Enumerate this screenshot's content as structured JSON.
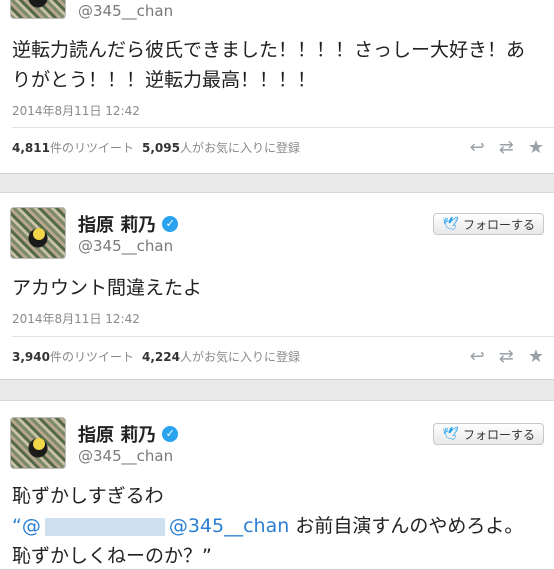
{
  "tweets": [
    {
      "handle": "@345__chan",
      "text_lines": [
        "逆転力読んだら彼氏できました！！！！さっしー大好き！あ",
        "りがとう！！！逆転力最高！！！！"
      ],
      "date": "2014年8月11日 12:42",
      "retweets": "4,811",
      "retweets_label": "件のリツイート",
      "favorites": "5,095",
      "favorites_label": "人がお気に入りに登録"
    },
    {
      "name": "指原 莉乃",
      "handle": "@345__chan",
      "follow_label": "フォローする",
      "text_lines": [
        "アカウント間違えたよ"
      ],
      "date": "2014年8月11日 12:42",
      "retweets": "3,940",
      "retweets_label": "件のリツイート",
      "favorites": "4,224",
      "favorites_label": "人がお気に入りに登録"
    },
    {
      "name": "指原 莉乃",
      "handle": "@345__chan",
      "follow_label": "フォローする",
      "line1": "恥ずかしすぎるわ",
      "open_quote": "“@",
      "mention": "@345__chan",
      "line2_rest": " お前自演すんのやめろよ。",
      "line3": "恥ずかしくねーのか？”"
    }
  ],
  "icons": {
    "reply": "reply-icon",
    "retweet": "retweet-icon",
    "favorite": "star-icon",
    "verified": "verified-badge-icon",
    "bird": "twitter-bird-icon"
  }
}
